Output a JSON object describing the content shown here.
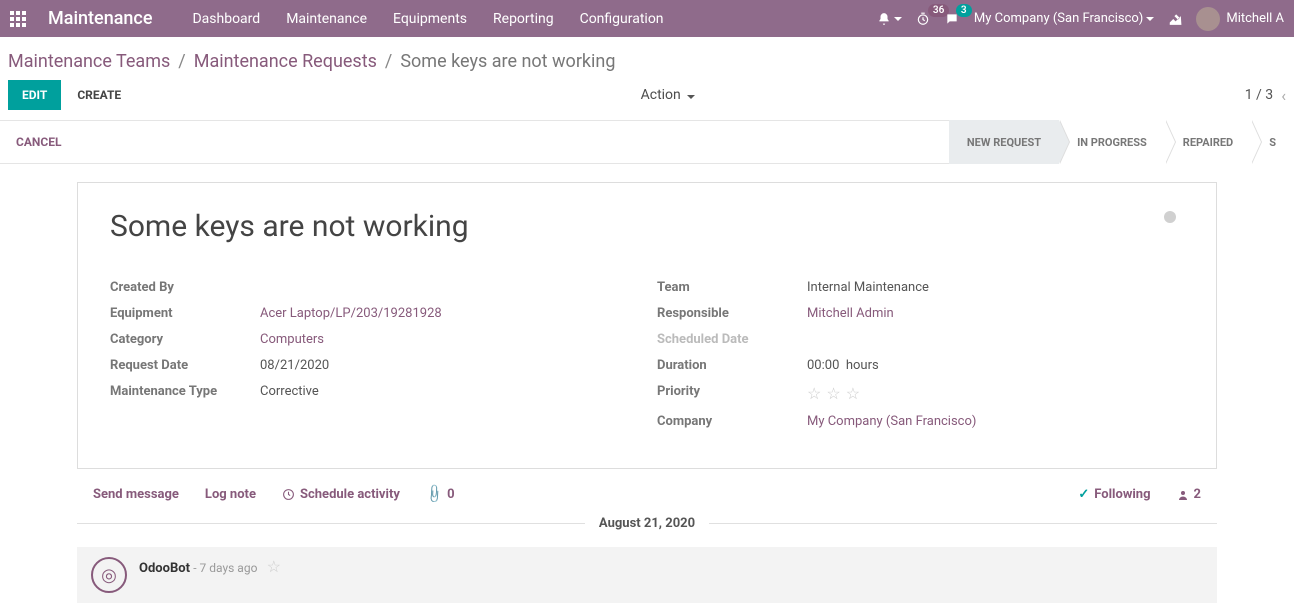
{
  "header": {
    "app_name": "Maintenance",
    "nav": [
      "Dashboard",
      "Maintenance",
      "Equipments",
      "Reporting",
      "Configuration"
    ],
    "counter_badge": "36",
    "chat_badge": "3",
    "company": "My Company (San Francisco)",
    "user_name": "Mitchell A"
  },
  "breadcrumbs": {
    "items": [
      "Maintenance Teams",
      "Maintenance Requests"
    ],
    "current": "Some keys are not working"
  },
  "controls": {
    "edit": "EDIT",
    "create": "CREATE",
    "action": "Action",
    "pager": "1 / 3",
    "cancel": "CANCEL"
  },
  "stages": [
    "NEW REQUEST",
    "IN PROGRESS",
    "REPAIRED",
    "S"
  ],
  "form": {
    "title": "Some keys are not working",
    "left": {
      "created_by_lbl": "Created By",
      "created_by_val": "",
      "equipment_lbl": "Equipment",
      "equipment_val": "Acer Laptop/LP/203/19281928",
      "category_lbl": "Category",
      "category_val": "Computers",
      "request_date_lbl": "Request Date",
      "request_date_val": "08/21/2020",
      "maint_type_lbl": "Maintenance Type",
      "maint_type_val": "Corrective"
    },
    "right": {
      "team_lbl": "Team",
      "team_val": "Internal Maintenance",
      "responsible_lbl": "Responsible",
      "responsible_val": "Mitchell Admin",
      "scheduled_lbl": "Scheduled Date",
      "scheduled_val": "",
      "duration_lbl": "Duration",
      "duration_val": "00:00",
      "duration_unit": "hours",
      "priority_lbl": "Priority",
      "company_lbl": "Company",
      "company_val": "My Company (San Francisco)"
    }
  },
  "messaging": {
    "send": "Send message",
    "log": "Log note",
    "schedule": "Schedule activity",
    "attach_count": "0",
    "following": "Following",
    "followers": "2",
    "date_sep": "August 21, 2020",
    "msg_author": "OdooBot",
    "msg_time": "- 7 days ago"
  }
}
